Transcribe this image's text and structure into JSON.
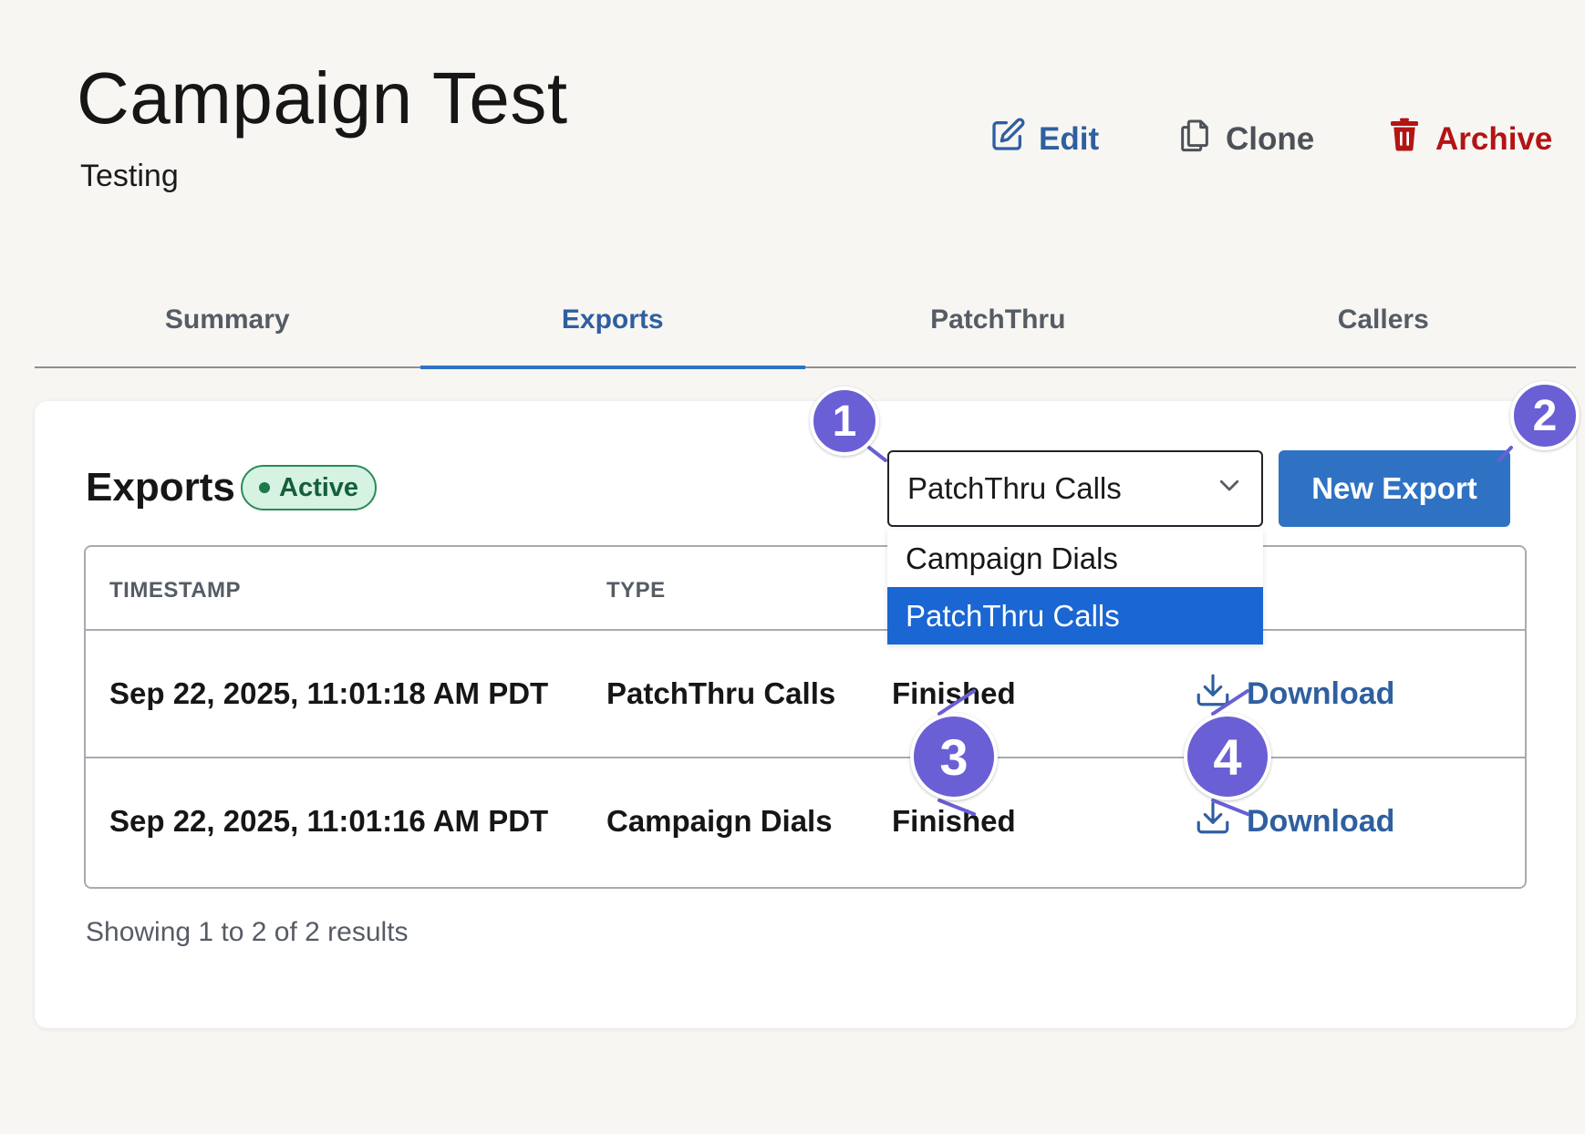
{
  "header": {
    "title": "Campaign Test",
    "subtitle": "Testing",
    "actions": {
      "edit": "Edit",
      "clone": "Clone",
      "archive": "Archive"
    }
  },
  "tabs": [
    {
      "label": "Summary",
      "active": false
    },
    {
      "label": "Exports",
      "active": true
    },
    {
      "label": "PatchThru",
      "active": false
    },
    {
      "label": "Callers",
      "active": false
    }
  ],
  "exports": {
    "title": "Exports",
    "status_badge": "Active",
    "select_value": "PatchThru Calls",
    "new_export_label": "New Export",
    "dropdown_options": [
      {
        "label": "Campaign Dials",
        "selected": false
      },
      {
        "label": "PatchThru Calls",
        "selected": true
      }
    ],
    "table": {
      "columns": [
        "TIMESTAMP",
        "TYPE"
      ],
      "rows": [
        {
          "timestamp": "Sep 22, 2025, 11:01:18 AM PDT",
          "type": "PatchThru Calls",
          "status": "Finished",
          "action": "Download"
        },
        {
          "timestamp": "Sep 22, 2025, 11:01:16 AM PDT",
          "type": "Campaign Dials",
          "status": "Finished",
          "action": "Download"
        }
      ]
    },
    "pagination_info": "Showing 1 to 2 of 2 results"
  },
  "annotations": [
    "1",
    "2",
    "3",
    "4"
  ],
  "colors": {
    "accent": "#2f72c4",
    "link": "#2f5fa0",
    "danger": "#b31414",
    "success_bg": "#d5f2e3",
    "marker": "#6a5fd4",
    "selected_option": "#1a66d2"
  },
  "icons": {
    "edit": "pencil-square-icon",
    "clone": "copy-icon",
    "archive": "trash-icon",
    "select": "chevron-down-icon",
    "download": "download-icon"
  }
}
